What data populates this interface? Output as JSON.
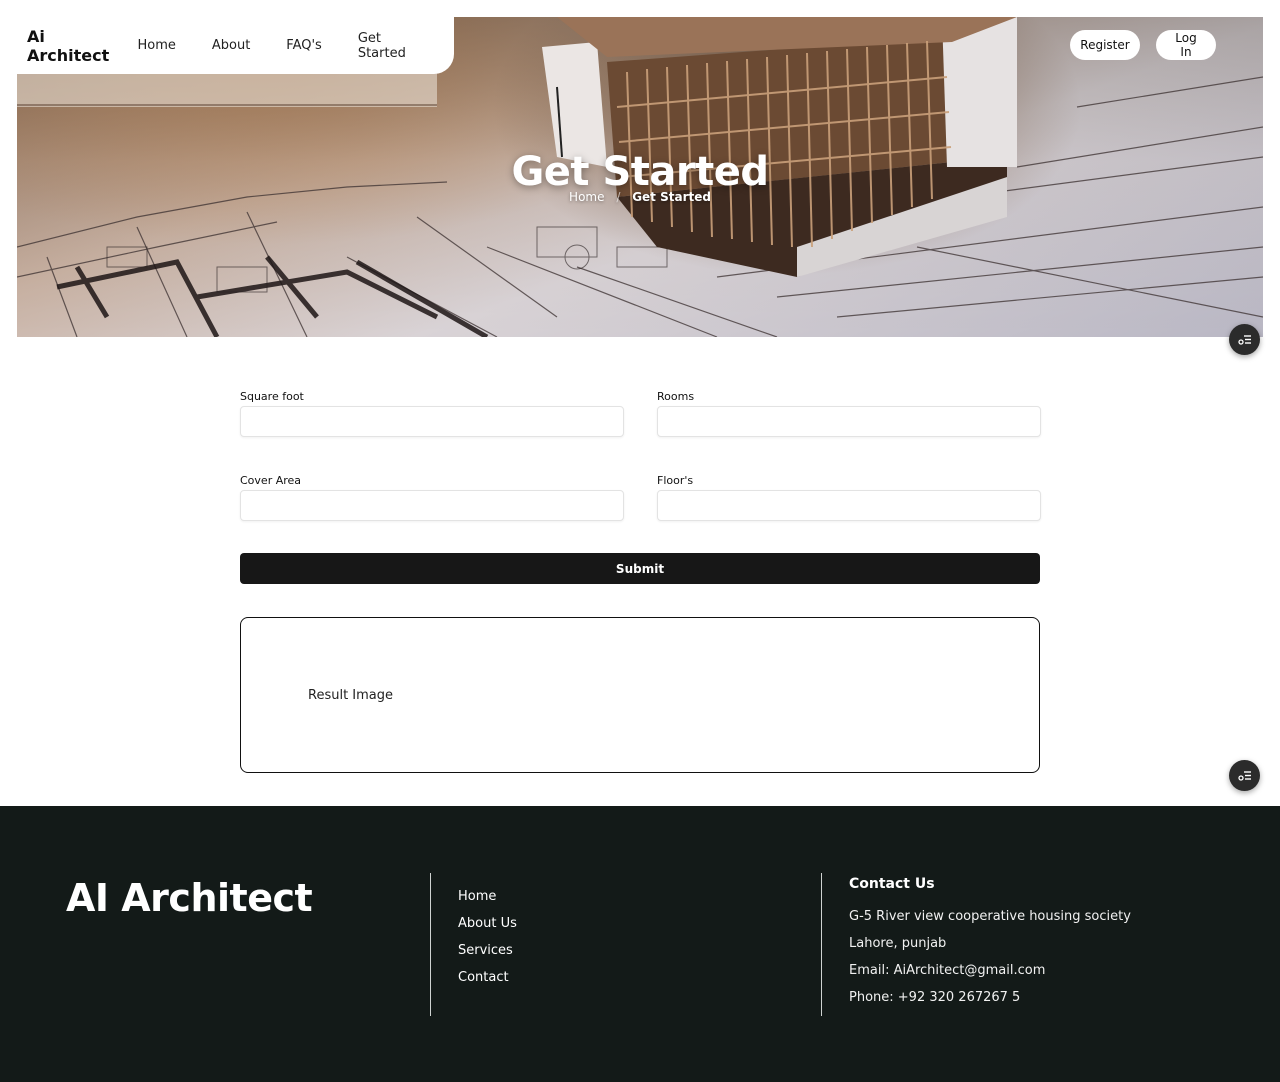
{
  "nav": {
    "brand": "Ai Architect",
    "links": [
      "Home",
      "About",
      "FAQ's",
      "Get Started"
    ],
    "register_label": "Register",
    "login_label": "Log In"
  },
  "hero": {
    "title": "Get Started",
    "breadcrumb": {
      "home": "Home",
      "separator": "/",
      "current": "Get Started"
    }
  },
  "form": {
    "square_foot_label": "Square foot",
    "rooms_label": "Rooms",
    "cover_area_label": "Cover Area",
    "floors_label": "Floor's",
    "square_foot_value": "",
    "rooms_value": "",
    "cover_area_value": "",
    "floors_value": "",
    "submit_label": "Submit",
    "result_label": "Result Image"
  },
  "footer": {
    "brand": "AI Architect",
    "links": [
      "Home",
      "About Us",
      "Services",
      "Contact"
    ],
    "contact_title": "Contact Us",
    "address_line1": "G-5 River view cooperative housing society",
    "address_line2": "Lahore, punjab",
    "email": "Email: AiArchitect@gmail.com",
    "phone": "Phone: +92 320 267267 5"
  },
  "colors": {
    "footer_bg": "#131a18",
    "submit_bg": "#171717",
    "float_button_bg": "#2b2b2b"
  },
  "icons": {
    "floating_button": "settings-list-icon"
  }
}
